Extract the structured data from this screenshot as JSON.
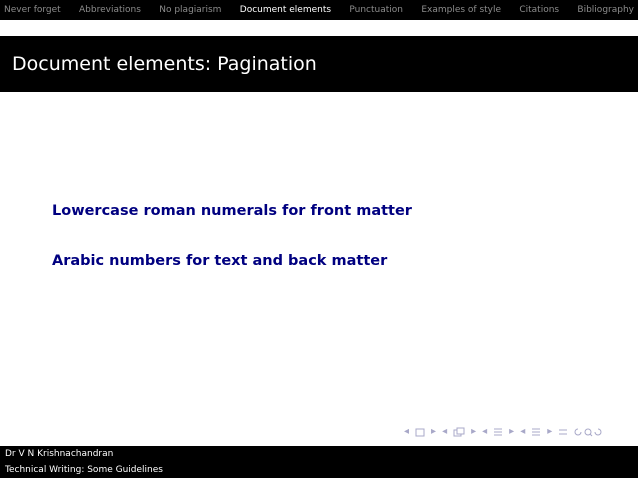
{
  "nav": {
    "items": [
      {
        "label": "Never forget",
        "active": false
      },
      {
        "label": "Abbreviations",
        "active": false
      },
      {
        "label": "No plagiarism",
        "active": false
      },
      {
        "label": "Document elements",
        "active": true
      },
      {
        "label": "Punctuation",
        "active": false
      },
      {
        "label": "Examples of style",
        "active": false
      },
      {
        "label": "Citations",
        "active": false
      },
      {
        "label": "Bibliography",
        "active": false
      }
    ]
  },
  "slide": {
    "title": "Document elements: Pagination",
    "bullets": [
      "Lowercase roman numerals for front matter",
      "Arabic numbers for text and back matter"
    ]
  },
  "footer": {
    "author": "Dr V N Krishnachandran",
    "talk_title": "Technical Writing: Some Guidelines"
  },
  "colors": {
    "bar": "#000000",
    "active_nav": "#ffffff",
    "inactive_nav": "#8c8c8c",
    "bullet_text": "#000080",
    "nav_icons": "#a8a8c8"
  },
  "beamer_nav_icons": [
    "prev-arrow-icon",
    "frame-icon",
    "next-arrow-icon",
    "prev-arrow-icon",
    "subsection-icon",
    "next-arrow-icon",
    "prev-arrow-icon",
    "section-icon",
    "next-arrow-icon",
    "prev-arrow-icon",
    "section-alt-icon",
    "next-arrow-icon",
    "align-icon",
    "search-icon"
  ]
}
